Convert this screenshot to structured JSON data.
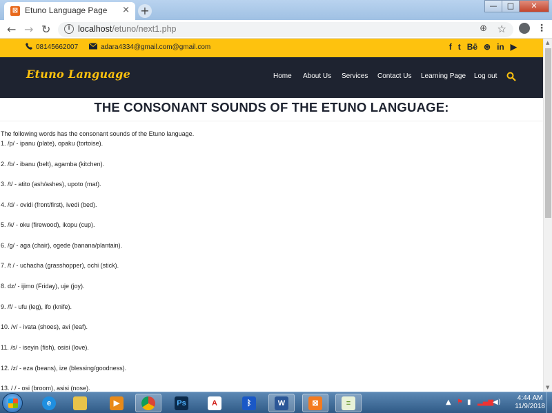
{
  "browser": {
    "tab_title": "Etuno Language Page",
    "tab_close": "×",
    "new_tab": "+",
    "url_host": "localhost",
    "url_path": "/etuno/next1.php",
    "window_min": "—",
    "window_max": "□",
    "window_close": "✕"
  },
  "topbar": {
    "phone": "08145662007",
    "email": "adara4334@gmail.com@gmail.com",
    "social_icons": [
      "facebook-icon",
      "twitter-icon",
      "behance-icon",
      "dribbble-icon",
      "linkedin-icon",
      "youtube-icon"
    ],
    "social_labels": [
      "f",
      "t",
      "Bē",
      "⊛",
      "in",
      "▶"
    ],
    "bg_color": "#fec20e"
  },
  "navbar": {
    "brand": "Etuno Language",
    "items": [
      "Home",
      "About Us",
      "Services",
      "Contact Us",
      "Learning Page",
      "Log out"
    ],
    "bg_color": "#1e2330"
  },
  "page": {
    "heading": "THE CONSONANT SOUNDS OF THE ETUNO LANGUAGE:",
    "intro": "The following words has the consonant sounds of the Etuno language.",
    "lines": [
      "1. /p/ - ipanu (plate), opaku (tortoise).",
      "2. /b/ - ibanu (belt), agamba (kitchen).",
      "3. /t/ - atito (ash/ashes), upoto (mat).",
      "4. /d/ - ovidi (front/first), ivedi (bed).",
      "5. /k/ - oku (firewood), ikopu (cup).",
      "6. /g/ - aga (chair), ogede (banana/plantain).",
      "7. /t / - uchacha (grasshopper), ochi (stick).",
      "8. dz/ - ijimo (Friday), uje (joy).",
      "9. /f/ - ufu (leg), ifo (knife).",
      "10. /v/ - ivata (shoes), avi (leaf).",
      "11. /s/ - iseyin (fish), osisi (love).",
      "12. /z/ - eza (beans), ize (blessing/goodness).",
      "13. / / - osi (broom), asisi (nose)."
    ]
  },
  "taskbar": {
    "apps": [
      "windows-explorer",
      "internet-explorer",
      "file-explorer",
      "media-player",
      "chrome",
      "photoshop",
      "acrobat",
      "bluetooth",
      "word",
      "xampp",
      "notepad-plus"
    ],
    "time": "4:44 AM",
    "date": "11/9/2018"
  }
}
